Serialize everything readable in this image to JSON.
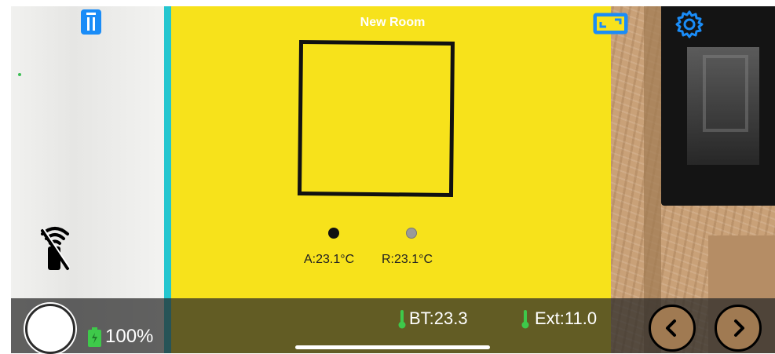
{
  "header": {
    "title": "New Room",
    "icons": [
      "trash-icon",
      "aspect-ratio-icon",
      "gear-icon"
    ]
  },
  "overlay": {
    "reading_a": "A:23.1°C",
    "reading_r": "R:23.1°C",
    "sensor_a_color": "#111111",
    "sensor_r_color": "#9a9a9a"
  },
  "bottom_bar": {
    "battery_level": "100%",
    "bt_reading": "BT:23.3",
    "ext_reading": "Ext:11.0"
  },
  "colors": {
    "accent_blue": "#1a8cf7",
    "highlight_yellow": "#f7e21b",
    "edge_cyan": "#25c6cf",
    "thermometer_green": "#3ec94a"
  }
}
